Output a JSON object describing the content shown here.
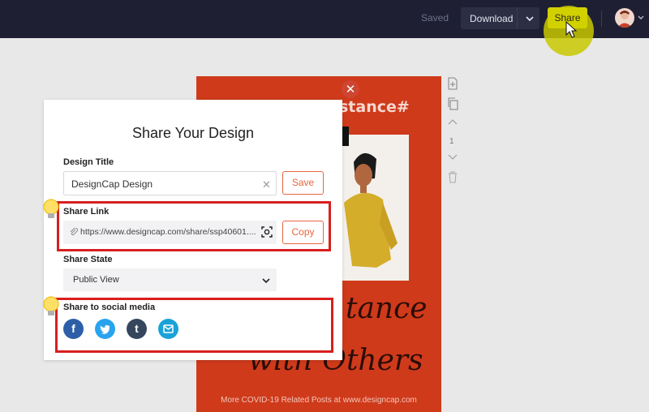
{
  "topbar": {
    "saved_label": "Saved",
    "download_label": "Download",
    "share_label": "Share"
  },
  "poster": {
    "heading": "stance#",
    "script_line1": "tance",
    "script_line2": "with Others",
    "footer": "More COVID-19 Related Posts at www.designcap.com",
    "page_number": "1"
  },
  "modal": {
    "title": "Share Your Design",
    "design_title_label": "Design Title",
    "design_title_value": "DesignCap Design",
    "save_label": "Save",
    "share_link_label": "Share Link",
    "share_link_value": "https://www.designcap.com/share/ssp40601....",
    "copy_label": "Copy",
    "share_state_label": "Share State",
    "share_state_value": "Public View",
    "social_label": "Share to social media",
    "social": [
      {
        "name": "facebook",
        "glyph": "f",
        "color": "#2d5fa8"
      },
      {
        "name": "twitter",
        "glyph": "",
        "color": "#2aa3ef"
      },
      {
        "name": "tumblr",
        "glyph": "t",
        "color": "#35465d"
      },
      {
        "name": "email",
        "glyph": "",
        "color": "#1aa2d8"
      }
    ]
  },
  "colors": {
    "accent": "#e8663f",
    "highlight": "#d81f1f",
    "share_button": "#d2d100",
    "poster_bg": "#cf3a1b"
  }
}
